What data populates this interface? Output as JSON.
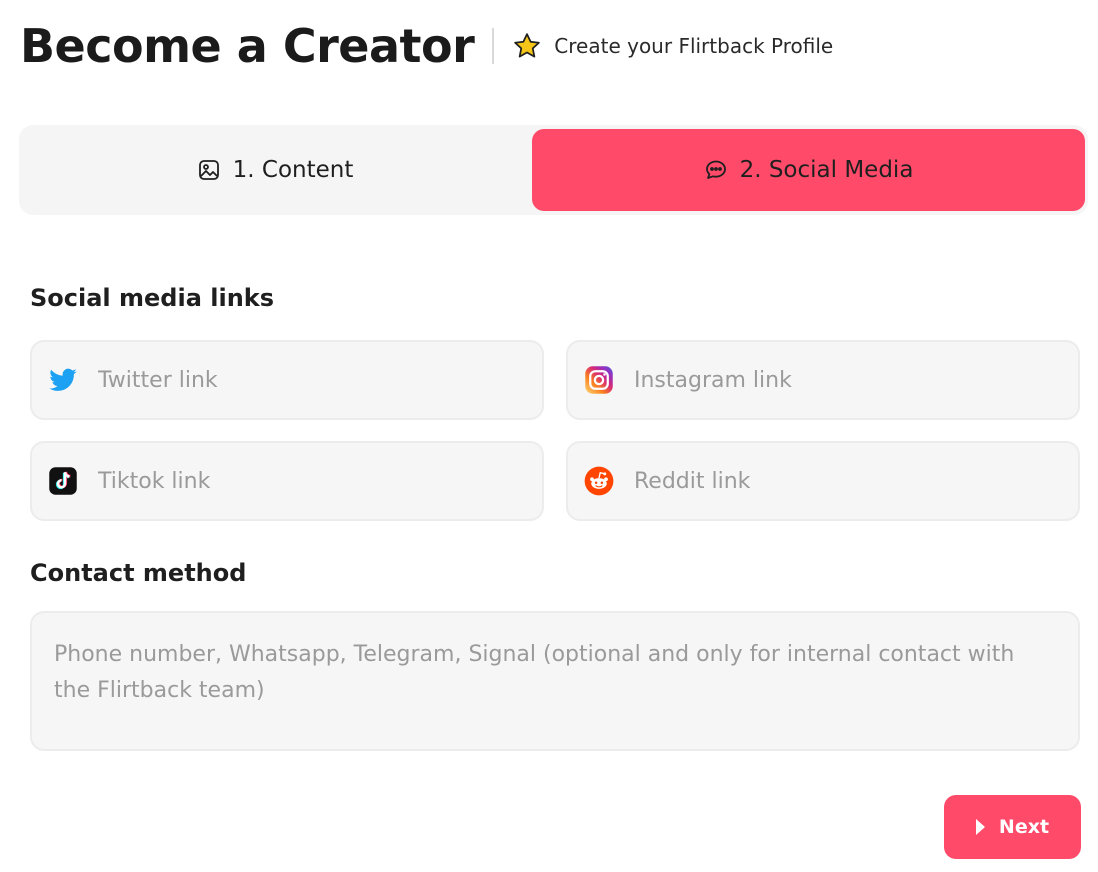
{
  "header": {
    "title": "Become a Creator",
    "subtitle": "Create your Flirtback Profile",
    "subtitle_icon": "star-icon"
  },
  "tabs": [
    {
      "label": "1. Content",
      "icon": "image-icon",
      "active": false
    },
    {
      "label": "2. Social Media",
      "icon": "chat-bubble-icon",
      "active": true
    }
  ],
  "social": {
    "section_label": "Social media links",
    "fields": {
      "twitter": {
        "placeholder": "Twitter link",
        "value": "",
        "icon": "twitter-icon"
      },
      "instagram": {
        "placeholder": "Instagram link",
        "value": "",
        "icon": "instagram-icon"
      },
      "tiktok": {
        "placeholder": "Tiktok link",
        "value": "",
        "icon": "tiktok-icon"
      },
      "reddit": {
        "placeholder": "Reddit link",
        "value": "",
        "icon": "reddit-icon"
      }
    }
  },
  "contact": {
    "section_label": "Contact method",
    "placeholder": "Phone number, Whatsapp, Telegram, Signal (optional and only for internal contact with the Flirtback team)",
    "value": ""
  },
  "actions": {
    "next_label": "Next"
  },
  "colors": {
    "accent": "#ff4b69",
    "field_bg": "#f6f6f6",
    "tab_bg": "#f5f5f5",
    "twitter": "#1da1f2",
    "reddit": "#ff4500",
    "star": "#f5c518"
  }
}
